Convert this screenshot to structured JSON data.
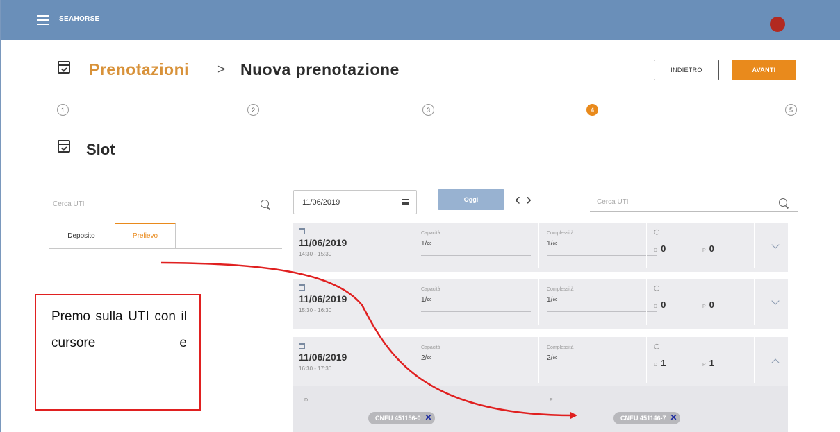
{
  "appbar": {
    "title": "SEAHORSE"
  },
  "header": {
    "breadcrumb_root": "Prenotazioni",
    "separator": ">",
    "breadcrumb_current": "Nuova prenotazione",
    "back_label": "INDIETRO",
    "next_label": "AVANTI"
  },
  "stepper": {
    "steps": [
      "1",
      "2",
      "3",
      "4",
      "5"
    ],
    "active_step": 4
  },
  "section": {
    "title": "Slot"
  },
  "left_panel": {
    "search_placeholder": "Cerca UTI",
    "tabs": [
      "Deposito",
      "Prelievo"
    ],
    "active_tab": "Prelievo"
  },
  "toolbar": {
    "date": "11/06/2019",
    "today_label": "Oggi",
    "search_placeholder": "Cerca UTI"
  },
  "slots": [
    {
      "date": "11/06/2019",
      "time": "14:30 - 15:30",
      "capacity_label": "Capacità",
      "capacity": "1/∞",
      "complexity_label": "Complessità",
      "complexity": "1/∞",
      "d_label": "D",
      "d": "0",
      "p_label": "P",
      "p": "0",
      "expanded": false
    },
    {
      "date": "11/06/2019",
      "time": "15:30 - 16:30",
      "capacity_label": "Capacità",
      "capacity": "1/∞",
      "complexity_label": "Complessità",
      "complexity": "1/∞",
      "d_label": "D",
      "d": "0",
      "p_label": "P",
      "p": "0",
      "expanded": false
    },
    {
      "date": "11/06/2019",
      "time": "16:30 - 17:30",
      "capacity_label": "Capacità",
      "capacity": "2/∞",
      "complexity_label": "Complessità",
      "complexity": "2/∞",
      "d_label": "D",
      "d": "1",
      "p_label": "P",
      "p": "1",
      "expanded": true
    }
  ],
  "expanded_detail": {
    "d_label": "D",
    "p_label": "P",
    "d_chip": "CNEU 451156-0",
    "p_chip": "CNEU 451146-7",
    "remove_symbol": "✕"
  },
  "annotation": {
    "text": "Premo sulla UTI con il cursore e",
    "color": "#e02020"
  },
  "colors": {
    "appbar": "#6a8fb9",
    "accent": "#e98a1c",
    "today_button": "#98b2d1"
  }
}
